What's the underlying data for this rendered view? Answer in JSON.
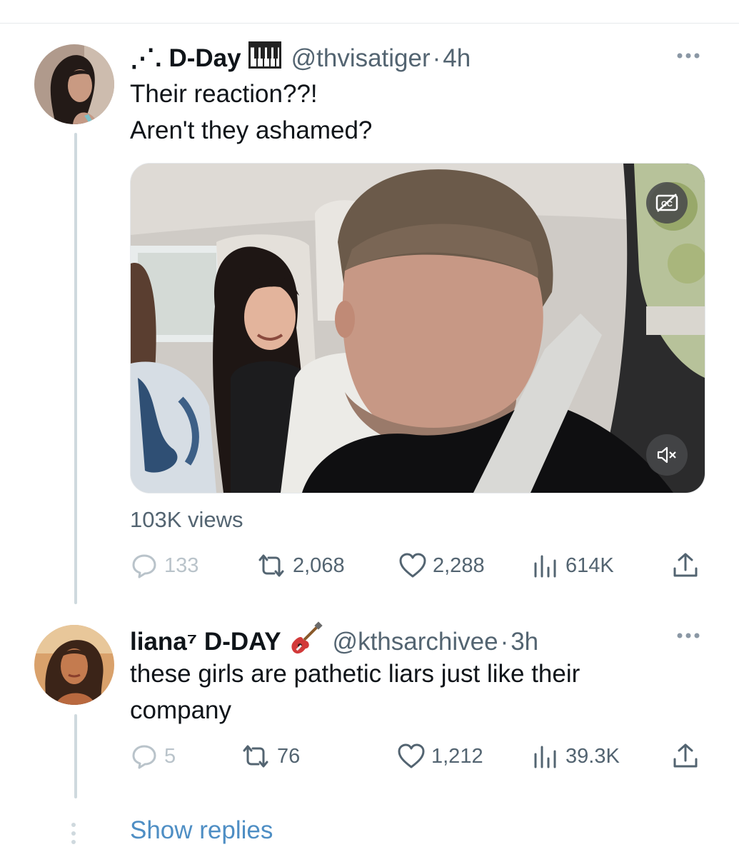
{
  "tweet1": {
    "display_name": "⋰. D-Day",
    "name_emoji": "piano-icon",
    "handle": "@thvisatiger",
    "separator": "·",
    "time": "4h",
    "text_line1": "Their reaction??!",
    "text_line2": "Aren't they ashamed?",
    "views_text": "103K views",
    "replies": "133",
    "retweets": "2,068",
    "likes": "2,288",
    "impressions": "614K"
  },
  "tweet2": {
    "display_name": "liana⁷ D-DAY",
    "name_emoji": "guitar-icon",
    "handle": "@kthsarchivee",
    "separator": "·",
    "time": "3h",
    "text_line1": "these girls are pathetic liars just like their",
    "text_line2": "company",
    "replies": "5",
    "retweets": "76",
    "likes": "1,212",
    "impressions": "39.3K"
  },
  "show_replies": "Show replies",
  "colors": {
    "text": "#0f1419",
    "secondary": "#536471",
    "link": "#4e8ec4",
    "thread_line": "#cfd9de"
  }
}
